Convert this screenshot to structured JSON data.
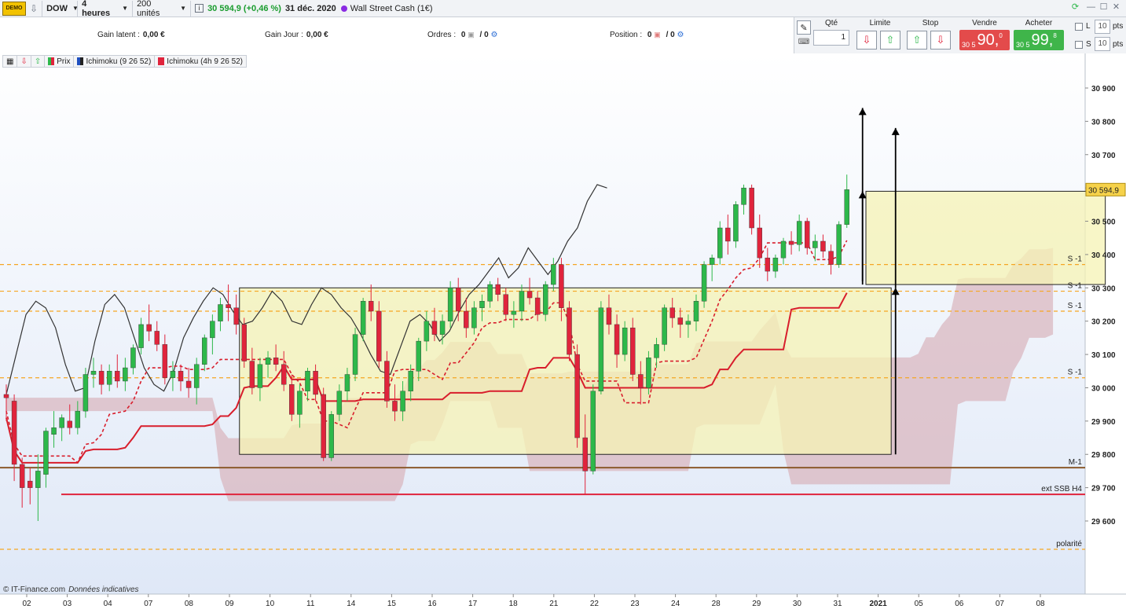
{
  "toolbar": {
    "demo_label": "DEMO",
    "instrument": "DOW",
    "timeframe": "4 heures",
    "units": "200 unités",
    "quote": "30 594,9 (+0,46 %)",
    "date": "31 déc. 2020",
    "market": "Wall Street Cash (1€)"
  },
  "status": {
    "gain_latent_label": "Gain latent :",
    "gain_latent_value": "0,00 €",
    "gain_jour_label": "Gain Jour :",
    "gain_jour_value": "0,00 €",
    "ordres_label": "Ordres :",
    "ordres_value_a": "0",
    "ordres_value_b": "/ 0",
    "position_label": "Position :",
    "position_value_a": "0",
    "position_value_b": "/ 0"
  },
  "order_panel": {
    "qte_label": "Qté",
    "qte_value": "1",
    "limite_label": "Limite",
    "stop_label": "Stop",
    "vendre_label": "Vendre",
    "acheter_label": "Acheter",
    "sell_prefix": "30 5",
    "sell_main": "90,",
    "sell_sup": "0",
    "buy_prefix": "30 5",
    "buy_main": "99,",
    "buy_sup": "8",
    "l_label": "L",
    "s_label": "S",
    "pts_value_l": "10",
    "pts_value_s": "10",
    "pts_label": "pts"
  },
  "legend": {
    "prix": "Prix",
    "ichimoku1": "Ichimoku (9 26 52)",
    "ichimoku2": "Ichimoku (4h 9 26 52)"
  },
  "footer": {
    "source": "© IT-Finance.com",
    "note": "Données indicatives"
  },
  "colors": {
    "bull": "#2db84a",
    "bear": "#e0243c",
    "kijun": "#d81e2c",
    "cloud": "#d9b3bc",
    "box": "#f5f3b4",
    "level": "#f5a623",
    "price_tag": "#f6d24a"
  },
  "chart_data": {
    "type": "candlestick",
    "instrument": "DOW",
    "timeframe": "4 heures",
    "x_tick_labels": [
      "02",
      "03",
      "04",
      "07",
      "08",
      "09",
      "10",
      "11",
      "14",
      "15",
      "16",
      "17",
      "18",
      "21",
      "22",
      "23",
      "24",
      "28",
      "29",
      "30",
      "31",
      "2021",
      "05",
      "06",
      "07",
      "08"
    ],
    "y_ticks": [
      29600,
      29700,
      29800,
      29900,
      30000,
      30100,
      30200,
      30300,
      30400,
      30500,
      30600,
      30700,
      30800,
      30900
    ],
    "y_tick_labels": [
      "29 600",
      "29 700",
      "29 800",
      "29 900",
      "30 000",
      "30 100",
      "30 200",
      "30 300",
      "30 400",
      "30 500",
      "30 600",
      "30 700",
      "30 800",
      "30 900"
    ],
    "ylim": [
      29500,
      31000
    ],
    "last_price": 30594.9,
    "last_price_label": "30 594,9",
    "levels": [
      {
        "label": "S -1",
        "value": 30370,
        "style": "dashed"
      },
      {
        "label": "S -1",
        "value": 30290,
        "style": "dashed"
      },
      {
        "label": "S -1",
        "value": 30230,
        "style": "dashed"
      },
      {
        "label": "S -1",
        "value": 30030,
        "style": "dashed"
      },
      {
        "label": "M-1",
        "value": 29760,
        "style": "solid-brown"
      },
      {
        "label": "ext SSB H4",
        "value": 29680,
        "style": "solid-red"
      },
      {
        "label": "polarité",
        "value": 29515,
        "style": "dashed"
      }
    ],
    "candles": [
      [
        29980,
        30010,
        29900,
        29970
      ],
      [
        29960,
        29980,
        29720,
        29770
      ],
      [
        29770,
        29790,
        29640,
        29700
      ],
      [
        29720,
        29760,
        29650,
        29700
      ],
      [
        29700,
        29800,
        29600,
        29750
      ],
      [
        29740,
        29880,
        29700,
        29870
      ],
      [
        29860,
        29930,
        29820,
        29880
      ],
      [
        29880,
        29920,
        29840,
        29910
      ],
      [
        29900,
        29950,
        29860,
        29880
      ],
      [
        29880,
        29960,
        29860,
        29930
      ],
      [
        29930,
        30060,
        29910,
        30040
      ],
      [
        30040,
        30090,
        30000,
        30050
      ],
      [
        30050,
        30070,
        29980,
        30010
      ],
      [
        30010,
        30070,
        29990,
        30050
      ],
      [
        30050,
        30100,
        30000,
        30020
      ],
      [
        30020,
        30090,
        29990,
        30060
      ],
      [
        30060,
        30130,
        30040,
        30120
      ],
      [
        30120,
        30210,
        30100,
        30190
      ],
      [
        30190,
        30250,
        30140,
        30170
      ],
      [
        30170,
        30200,
        30110,
        30130
      ],
      [
        30130,
        30160,
        30010,
        30030
      ],
      [
        30030,
        30080,
        29990,
        30050
      ],
      [
        30050,
        30070,
        29990,
        30020
      ],
      [
        30020,
        30060,
        29970,
        30000
      ],
      [
        30000,
        30090,
        29950,
        30070
      ],
      [
        30070,
        30160,
        30050,
        30150
      ],
      [
        30150,
        30220,
        30100,
        30200
      ],
      [
        30200,
        30270,
        30170,
        30250
      ],
      [
        30250,
        30310,
        30200,
        30240
      ],
      [
        30240,
        30280,
        30160,
        30190
      ],
      [
        30190,
        30210,
        30060,
        30080
      ],
      [
        30080,
        30120,
        29980,
        30000
      ],
      [
        30000,
        30090,
        29960,
        30070
      ],
      [
        30070,
        30110,
        30030,
        30090
      ],
      [
        30090,
        30130,
        30050,
        30070
      ],
      [
        30070,
        30110,
        29990,
        30010
      ],
      [
        30010,
        30040,
        29900,
        29920
      ],
      [
        29920,
        30010,
        29880,
        29990
      ],
      [
        29990,
        30060,
        29960,
        30050
      ],
      [
        30050,
        30070,
        29960,
        29980
      ],
      [
        29980,
        30000,
        29780,
        29790
      ],
      [
        29790,
        29930,
        29780,
        29920
      ],
      [
        29920,
        30010,
        29900,
        29990
      ],
      [
        29990,
        30060,
        29960,
        30040
      ],
      [
        30040,
        30180,
        30020,
        30160
      ],
      [
        30160,
        30270,
        30140,
        30260
      ],
      [
        30260,
        30310,
        30200,
        30230
      ],
      [
        30230,
        30260,
        30060,
        30080
      ],
      [
        30080,
        30110,
        29940,
        29960
      ],
      [
        29960,
        30010,
        29900,
        29930
      ],
      [
        29930,
        30020,
        29900,
        29990
      ],
      [
        29990,
        30070,
        29960,
        30050
      ],
      [
        30050,
        30150,
        30020,
        30140
      ],
      [
        30140,
        30230,
        30110,
        30200
      ],
      [
        30200,
        30240,
        30140,
        30160
      ],
      [
        30160,
        30220,
        30130,
        30200
      ],
      [
        30200,
        30320,
        30180,
        30300
      ],
      [
        30300,
        30330,
        30200,
        30230
      ],
      [
        30230,
        30270,
        30150,
        30180
      ],
      [
        30180,
        30260,
        30160,
        30240
      ],
      [
        30240,
        30280,
        30200,
        30260
      ],
      [
        30260,
        30320,
        30240,
        30310
      ],
      [
        30310,
        30330,
        30260,
        30280
      ],
      [
        30280,
        30300,
        30200,
        30220
      ],
      [
        30220,
        30260,
        30180,
        30230
      ],
      [
        30230,
        30310,
        30200,
        30290
      ],
      [
        30290,
        30330,
        30250,
        30270
      ],
      [
        30270,
        30290,
        30200,
        30220
      ],
      [
        30220,
        30320,
        30200,
        30310
      ],
      [
        30310,
        30390,
        30290,
        30370
      ],
      [
        30370,
        30390,
        30200,
        30240
      ],
      [
        30240,
        30260,
        30080,
        30100
      ],
      [
        30100,
        30130,
        29820,
        29850
      ],
      [
        29850,
        29920,
        29680,
        29750
      ],
      [
        29750,
        30010,
        29740,
        29990
      ],
      [
        29990,
        30260,
        29980,
        30240
      ],
      [
        30240,
        30280,
        30160,
        30190
      ],
      [
        30190,
        30220,
        30060,
        30100
      ],
      [
        30100,
        30200,
        30080,
        30180
      ],
      [
        30180,
        30210,
        30020,
        30040
      ],
      [
        30040,
        30080,
        29950,
        30000
      ],
      [
        30000,
        30110,
        29980,
        30090
      ],
      [
        30090,
        30150,
        30060,
        30130
      ],
      [
        30130,
        30250,
        30110,
        30240
      ],
      [
        30240,
        30270,
        30180,
        30210
      ],
      [
        30210,
        30240,
        30150,
        30190
      ],
      [
        30190,
        30220,
        30150,
        30200
      ],
      [
        30200,
        30280,
        30170,
        30260
      ],
      [
        30260,
        30380,
        30240,
        30370
      ],
      [
        30370,
        30400,
        30320,
        30390
      ],
      [
        30390,
        30500,
        30370,
        30480
      ],
      [
        30480,
        30520,
        30400,
        30440
      ],
      [
        30440,
        30560,
        30420,
        30550
      ],
      [
        30550,
        30610,
        30520,
        30600
      ],
      [
        30600,
        30610,
        30460,
        30480
      ],
      [
        30480,
        30520,
        30360,
        30390
      ],
      [
        30390,
        30420,
        30320,
        30350
      ],
      [
        30350,
        30400,
        30330,
        30390
      ],
      [
        30390,
        30450,
        30370,
        30440
      ],
      [
        30440,
        30470,
        30400,
        30430
      ],
      [
        30430,
        30520,
        30410,
        30500
      ],
      [
        30500,
        30510,
        30400,
        30420
      ],
      [
        30420,
        30460,
        30380,
        30440
      ],
      [
        30440,
        30460,
        30390,
        30410
      ],
      [
        30410,
        30430,
        30340,
        30370
      ],
      [
        30370,
        30500,
        30360,
        30490
      ],
      [
        30490,
        30640,
        30480,
        30594.9
      ]
    ],
    "ichimoku_chikou": [
      29980,
      30100,
      30220,
      30260,
      30240,
      30180,
      30070,
      29990,
      30000,
      30140,
      30250,
      30280,
      30240,
      30150,
      30060,
      30010,
      29990,
      30050,
      30150,
      30210,
      30260,
      30300,
      30280,
      30230,
      30190,
      30200,
      30240,
      30290,
      30260,
      30200,
      30190,
      30250,
      30300,
      30280,
      30240,
      30210,
      30160,
      30100,
      30050,
      30040,
      30120,
      30200,
      30220,
      30190,
      30140,
      30170,
      30230,
      30280,
      30310,
      30350,
      30390,
      30330,
      30360,
      30420,
      30380,
      30340,
      30380,
      30440,
      30480,
      30560,
      30610,
      30600
    ],
    "overlay_boxes": [
      {
        "start": 30,
        "end": 111,
        "low": 29800,
        "high": 30300
      },
      {
        "start": 109,
        "end": 138,
        "low": 30310,
        "high": 30590
      }
    ]
  }
}
